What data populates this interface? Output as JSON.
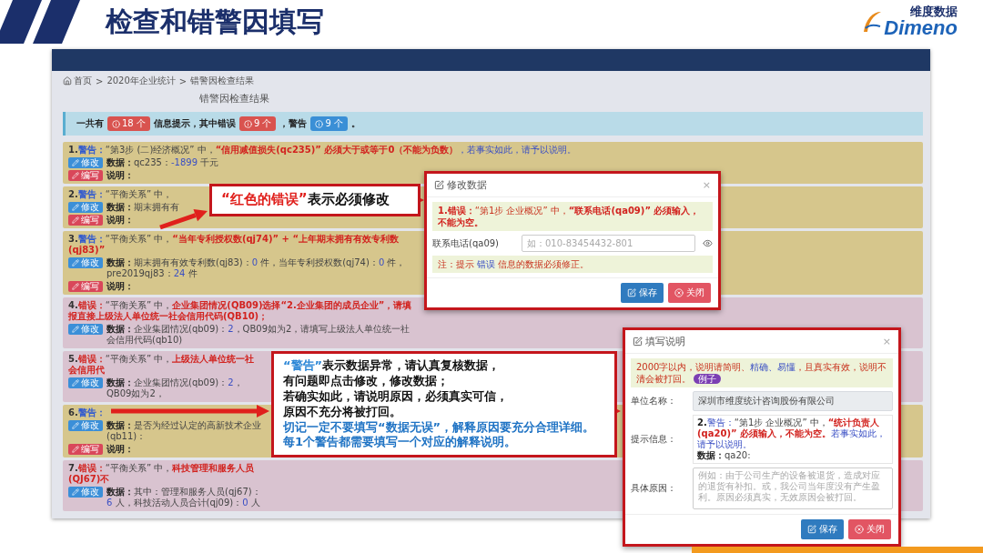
{
  "slide": {
    "title": "检查和错警因填写",
    "logo": {
      "cn": "维度数据",
      "en": "Dimeno"
    }
  },
  "app": {
    "breadcrumb": {
      "separator": ">",
      "items": [
        "首页",
        "2020年企业统计",
        "错警因检查结果"
      ]
    },
    "heading": "错警因检查结果",
    "summary": [
      {
        "kind": "text",
        "text": "一共有"
      },
      {
        "kind": "badge",
        "text": "18 个",
        "color": "#d9534f"
      },
      {
        "kind": "text",
        "text": "信息提示，其中错误"
      },
      {
        "kind": "badge",
        "text": "9 个",
        "color": "#d9534f"
      },
      {
        "kind": "text",
        "text": "，警告"
      },
      {
        "kind": "badge",
        "text": "9 个",
        "color": "#3a8fd6"
      },
      {
        "kind": "text",
        "text": "。"
      }
    ],
    "results": [
      {
        "number": "1.",
        "kind": "warning",
        "label": "警告：",
        "message": [
          {
            "kind": "plain",
            "text": "“第3步 (二)经济概况” 中，"
          },
          {
            "kind": "red",
            "text": "“信用减值损失(qc235)” 必须大于或等于0（不能为负数）"
          },
          {
            "kind": "blue",
            "text": "，若事实如此，请予以说明。"
          }
        ],
        "edit_button": "修改",
        "data_label": "数据：",
        "data": [
          {
            "kind": "plain",
            "text": "qc235："
          },
          {
            "kind": "blue",
            "text": "-1899"
          },
          {
            "kind": "plain",
            "text": " 千元"
          }
        ],
        "explain_button": "编写",
        "explain_label": "说明："
      },
      {
        "number": "2.",
        "kind": "warning",
        "label": "警告：",
        "message": [
          {
            "kind": "plain",
            "text": "“平衡关系” 中，"
          }
        ],
        "edit_button": "修改",
        "data_label": "数据：",
        "data": [
          {
            "kind": "plain",
            "text": "期末拥有有"
          }
        ],
        "explain_button": "编写",
        "explain_label": "说明："
      },
      {
        "number": "3.",
        "kind": "warning",
        "label": "警告：",
        "message": [
          {
            "kind": "plain",
            "text": "“平衡关系” 中，"
          },
          {
            "kind": "red",
            "text": "“当年专利授权数(qj74)” + “上年期末拥有有效专利数(qj83)”"
          }
        ],
        "edit_button": "修改",
        "data_label": "数据：",
        "data": [
          {
            "kind": "plain",
            "text": "期末拥有有效专利数(qj83)："
          },
          {
            "kind": "blue",
            "text": "0"
          },
          {
            "kind": "plain",
            "text": " 件，当年专利授权数(qj74)："
          },
          {
            "kind": "blue",
            "text": "0"
          },
          {
            "kind": "plain",
            "text": " 件，pre2019qj83："
          },
          {
            "kind": "blue",
            "text": "24"
          },
          {
            "kind": "plain",
            "text": " 件"
          }
        ],
        "explain_button": "编写",
        "explain_label": "说明："
      },
      {
        "number": "4.",
        "kind": "error",
        "label": "错误：",
        "message": [
          {
            "kind": "plain",
            "text": "“平衡关系” 中，"
          },
          {
            "kind": "red",
            "text": "企业集团情况(QB09)选择“2.企业集团的成员企业”，请填报直接上级法人单位统一社会信用代码(QB10)；"
          }
        ],
        "edit_button": "修改",
        "data_label": "数据：",
        "data": [
          {
            "kind": "plain",
            "text": "企业集团情况(qb09)："
          },
          {
            "kind": "blue",
            "text": "2"
          },
          {
            "kind": "plain",
            "text": "，QB09如为2，请填写上级法人单位统一社会信用代码(qb10)"
          }
        ]
      },
      {
        "number": "5.",
        "kind": "error",
        "label": "错误：",
        "message": [
          {
            "kind": "plain",
            "text": "“平衡关系” 中，"
          },
          {
            "kind": "red",
            "text": "上级法人单位统一社会信用代"
          }
        ],
        "edit_button": "修改",
        "data_label": "数据：",
        "data": [
          {
            "kind": "plain",
            "text": "企业集团情况(qb09)："
          },
          {
            "kind": "blue",
            "text": "2"
          },
          {
            "kind": "plain",
            "text": "，QB09如为2，"
          }
        ]
      },
      {
        "number": "6.",
        "kind": "warning",
        "label": "警告：",
        "edit_button": "修改",
        "data_label": "数据：",
        "data": [
          {
            "kind": "plain",
            "text": "是否为经过认定的高新技术企业(qb11)："
          }
        ],
        "explain_button": "编写",
        "explain_label": "说明："
      },
      {
        "number": "7.",
        "kind": "error",
        "label": "错误：",
        "message": [
          {
            "kind": "plain",
            "text": "“平衡关系” 中，"
          },
          {
            "kind": "red",
            "text": "科技管理和服务人员(QJ67)不"
          }
        ],
        "edit_button": "修改",
        "data_label": "数据：",
        "data": [
          {
            "kind": "plain",
            "text": "其中：管理和服务人员(qj67)："
          },
          {
            "kind": "blue",
            "text": "6"
          },
          {
            "kind": "plain",
            "text": " 人，科技活动人员合计(qj09)："
          },
          {
            "kind": "blue",
            "text": "0"
          },
          {
            "kind": "plain",
            "text": " 人"
          }
        ]
      }
    ]
  },
  "edit_modal": {
    "title": "修改数据",
    "close": "×",
    "alert": [
      {
        "kind": "red",
        "text": "1.错误："
      },
      {
        "kind": "redlight",
        "text": "“第1步 企业概况” 中，"
      },
      {
        "kind": "red",
        "text": "“联系电话(qa09)” 必须输入，不能为空。"
      }
    ],
    "field_label": "联系电话(qa09)",
    "placeholder": "如：010-83454432-801",
    "note": [
      {
        "kind": "redlight",
        "text": "注：提示 "
      },
      {
        "kind": "blue",
        "text": "错误"
      },
      {
        "kind": "redlight",
        "text": " 信息的数据必须修正。"
      }
    ],
    "buttons": [
      {
        "kind": "primary",
        "label": "保存"
      },
      {
        "kind": "danger",
        "label": "关闭"
      }
    ]
  },
  "explain_modal": {
    "title": "填写说明",
    "close": "×",
    "alert": [
      {
        "kind": "redlight",
        "text": "2000字以内，说明请简明、"
      },
      {
        "kind": "blue",
        "text": "精确、易懂"
      },
      {
        "kind": "redlight",
        "text": "，且真实有效，说明不清会被打回。"
      }
    ],
    "alert_badge": "例子",
    "fields": [
      {
        "kind": "readonly",
        "label": "单位名称：",
        "value": "深圳市维度统计咨询股份有限公司"
      },
      {
        "kind": "message",
        "label": "提示信息：",
        "lines": [
          [
            {
              "kind": "strong",
              "text": "2."
            },
            {
              "kind": "blue",
              "text": "警告："
            },
            {
              "kind": "plain",
              "text": "“第1步 企业概况” 中，"
            },
            {
              "kind": "red",
              "text": "“统计负责人(qa20)” 必须输入，不能为空。"
            },
            {
              "kind": "blue",
              "text": "若事实如此，请予以说明。"
            }
          ],
          [
            {
              "kind": "strong",
              "text": "数据："
            },
            {
              "kind": "plain",
              "text": "qa20:"
            }
          ]
        ]
      },
      {
        "kind": "textarea",
        "label": "具体原因：",
        "placeholder": "例如：由于公司生产的设备被退货，造成对应的退货有补扣。或，我公司当年度没有产生盈利。原因必须真实，无效原因会被打回。"
      }
    ],
    "buttons": [
      {
        "kind": "primary",
        "label": "保存"
      },
      {
        "kind": "danger",
        "label": "关闭"
      }
    ]
  },
  "callouts": [
    {
      "lines": [
        [
          {
            "kind": "quote-red",
            "text": "“红色的错误”"
          },
          {
            "kind": "dark",
            "text": "表示必须修改"
          }
        ]
      ]
    },
    {
      "lines": [
        [
          {
            "kind": "quote-blue",
            "text": "“警告”"
          },
          {
            "kind": "dark",
            "text": "表示数据异常，请认真复核数据，"
          }
        ],
        [
          {
            "kind": "dark",
            "text": "有问题即点击修改，修改数据；"
          }
        ],
        [
          {
            "kind": "dark",
            "text": "若确实如此，请说明原因，必须真实可信，"
          }
        ],
        [
          {
            "kind": "dark",
            "text": "原因不充分将被打回。"
          }
        ],
        [
          {
            "kind": "emph-blue",
            "text": "切记一定不要填写“数据无误”，解释原因要充分合理详细。"
          }
        ],
        [
          {
            "kind": "emph-blue",
            "text": "每1个警告都需要填写一个对应的解释说明。"
          }
        ]
      ]
    }
  ]
}
